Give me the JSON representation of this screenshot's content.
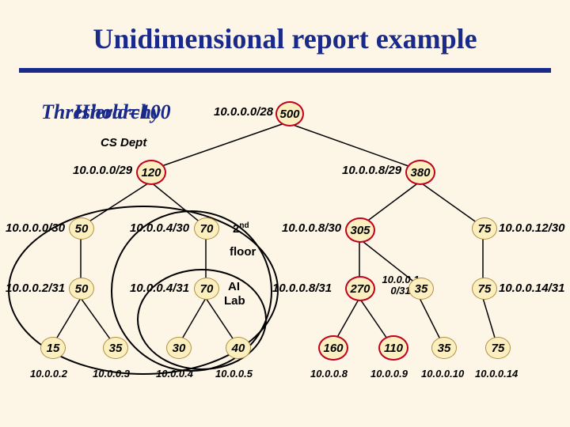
{
  "title": "Unidimensional report example",
  "subtitle": "Threshold=100",
  "labels": {
    "hierarchy_overlay": "Hierarchy",
    "root_prefix": "10.0.0.0/28",
    "cs_dept": "CS Dept",
    "n29_left": "10.0.0.0/29",
    "n29_right": "10.0.0.8/29",
    "n30_0": "10.0.0.0/30",
    "n30_4": "10.0.0.4/30",
    "n30_8": "10.0.0.8/30",
    "n30_12": "10.0.0.12/30",
    "n31_2": "10.0.0.2/31",
    "n31_4": "10.0.0.4/31",
    "n31_8": "10.0.0.8/31",
    "n31_10": "10.0.0.1\n0/31",
    "n31_14": "10.0.0.14/31",
    "second": "2",
    "nd": "nd",
    "floor": "floor",
    "ai": "AI",
    "lab": "Lab",
    "ip2": "10.0.0.2",
    "ip3": "10.0.0.3",
    "ip4": "10.0.0.4",
    "ip5": "10.0.0.5",
    "ip8": "10.0.0.8",
    "ip9": "10.0.0.9",
    "ip10": "10.0.0.10",
    "ip14": "10.0.0.14"
  },
  "nodes": {
    "root": "500",
    "l29": "120",
    "r29": "380",
    "n0_30": "50",
    "n4_30": "70",
    "n8_30": "305",
    "n12_30": "75",
    "n2_31": "50",
    "n4_31": "70",
    "n8_31": "270",
    "n10_31": "35",
    "n12_31": "75",
    "leaf15": "15",
    "leaf35a": "35",
    "leaf30": "30",
    "leaf40": "40",
    "leaf160": "160",
    "leaf110": "110",
    "leaf35b": "35",
    "leaf75": "75"
  }
}
